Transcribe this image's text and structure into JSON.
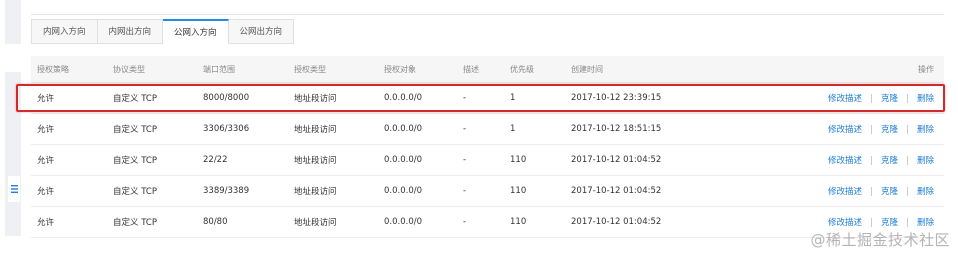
{
  "tabs": [
    {
      "label": "内网入方向",
      "active": false
    },
    {
      "label": "内网出方向",
      "active": false
    },
    {
      "label": "公网入方向",
      "active": true
    },
    {
      "label": "公网出方向",
      "active": false
    }
  ],
  "table": {
    "headers": {
      "policy": "授权策略",
      "protocol": "协议类型",
      "port_range": "端口范围",
      "auth_type": "授权类型",
      "auth_object": "授权对象",
      "description": "描述",
      "priority": "优先级",
      "created": "创建时间",
      "actions": "操作"
    },
    "action_labels": {
      "edit": "修改描述",
      "clone": "克隆",
      "delete": "删除"
    },
    "rows": [
      {
        "policy": "允许",
        "protocol": "自定义 TCP",
        "port_range": "8000/8000",
        "auth_type": "地址段访问",
        "auth_object": "0.0.0.0/0",
        "description": "-",
        "priority": "1",
        "created": "2017-10-12 23:39:15",
        "highlighted": true
      },
      {
        "policy": "允许",
        "protocol": "自定义 TCP",
        "port_range": "3306/3306",
        "auth_type": "地址段访问",
        "auth_object": "0.0.0.0/0",
        "description": "-",
        "priority": "1",
        "created": "2017-10-12 18:51:15"
      },
      {
        "policy": "允许",
        "protocol": "自定义 TCP",
        "port_range": "22/22",
        "auth_type": "地址段访问",
        "auth_object": "0.0.0.0/0",
        "description": "-",
        "priority": "110",
        "created": "2017-10-12 01:04:52"
      },
      {
        "policy": "允许",
        "protocol": "自定义 TCP",
        "port_range": "3389/3389",
        "auth_type": "地址段访问",
        "auth_object": "0.0.0.0/0",
        "description": "-",
        "priority": "110",
        "created": "2017-10-12 01:04:52"
      },
      {
        "policy": "允许",
        "protocol": "自定义 TCP",
        "port_range": "80/80",
        "auth_type": "地址段访问",
        "auth_object": "0.0.0.0/0",
        "description": "-",
        "priority": "110",
        "created": "2017-10-12 01:04:52"
      }
    ]
  },
  "watermark": "@稀土掘金技术社区",
  "colors": {
    "accent": "#1f8ee6",
    "link": "#1f7ed8",
    "highlight": "#d12a2a"
  },
  "icons": {
    "sidebar_toggle": "menu-lines-icon"
  }
}
